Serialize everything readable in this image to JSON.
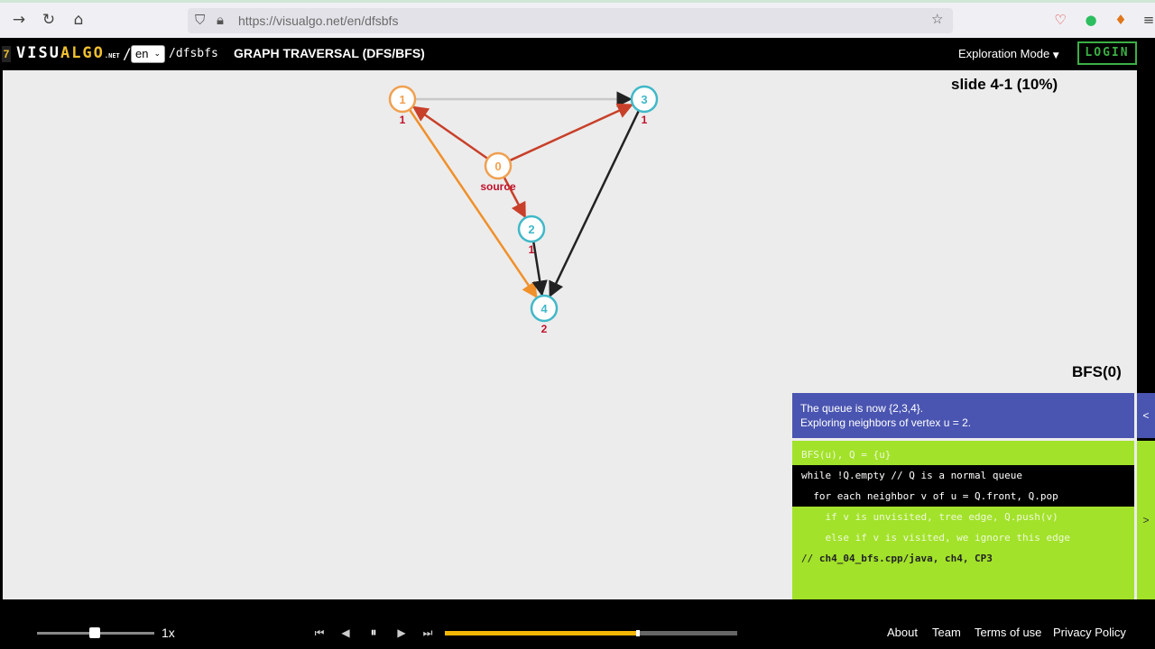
{
  "browser": {
    "url": "https://visualgo.net/en/dfsbfs",
    "icons": [
      "back-arrow-icon",
      "reload-icon",
      "home-icon",
      "shield-icon",
      "lock-icon",
      "star-icon",
      "pocket-icon",
      "evernote-icon",
      "metamask-icon",
      "menu-icon"
    ]
  },
  "header": {
    "logo_num": "7",
    "logo_pre": "VISU",
    "logo_accent": "ALGO",
    "logo_suffix": ".NET",
    "logo_slash": "/",
    "lang": "en",
    "path": "/dfsbfs",
    "title": "GRAPH TRAVERSAL (DFS/BFS)",
    "mode": "Exploration Mode",
    "login": "LOGIN"
  },
  "canvas": {
    "slide": "slide 4-1 (10%)",
    "algo_title": "BFS(0)",
    "status_lines": [
      "The queue is now {2,3,4}.",
      "Exploring neighbors of vertex u = 2."
    ],
    "code": [
      {
        "text": "BFS(u), Q = {u}",
        "style": "dim"
      },
      {
        "text": "while !Q.empty // Q is a normal queue",
        "style": "hl"
      },
      {
        "text": "  for each neighbor v of u = Q.front, Q.pop",
        "style": "hl"
      },
      {
        "text": "    if v is unvisited, tree edge, Q.push(v)",
        "style": "dim"
      },
      {
        "text": "    else if v is visited, we ignore this edge",
        "style": "dim"
      },
      {
        "text_prefix": "// ",
        "text_bold": "ch4_04_bfs.cpp/java, ch4, CP3",
        "style": "cmt"
      }
    ],
    "status_tab_glyph": "<",
    "code_tab_glyph": ">"
  },
  "graph": {
    "vertices": [
      {
        "id": "0",
        "label": "0",
        "sub": "source",
        "state": "explored"
      },
      {
        "id": "1",
        "label": "1",
        "sub": "1",
        "state": "explored"
      },
      {
        "id": "2",
        "label": "2",
        "sub": "1",
        "state": "frontier"
      },
      {
        "id": "3",
        "label": "3",
        "sub": "1",
        "state": "frontier"
      },
      {
        "id": "4",
        "label": "4",
        "sub": "2",
        "state": "frontier"
      }
    ],
    "edges": [
      {
        "from": "1",
        "to": "3",
        "state": "ignored"
      },
      {
        "from": "0",
        "to": "1",
        "state": "tree-explored"
      },
      {
        "from": "0",
        "to": "3",
        "state": "tree-explored"
      },
      {
        "from": "0",
        "to": "2",
        "state": "tree-explored"
      },
      {
        "from": "1",
        "to": "4",
        "state": "tree"
      },
      {
        "from": "2",
        "to": "4",
        "state": "active"
      },
      {
        "from": "3",
        "to": "4",
        "state": "active"
      }
    ],
    "colors": {
      "explored_vertex": "#f0a050",
      "frontier_vertex": "#40b8c8",
      "edge_explored": "#c8402a",
      "edge_tree": "#f0902a",
      "edge_active": "#222222",
      "edge_ignored": "#c8c8c8",
      "sub_label": "#c0102a"
    }
  },
  "player": {
    "speed": "1x",
    "progress": 0.66,
    "icons": [
      "skip-start-icon",
      "step-back-icon",
      "pause-icon",
      "step-forward-icon",
      "skip-end-icon"
    ]
  },
  "footer": {
    "about": "About",
    "team": "Team",
    "terms": "Terms of use",
    "privacy": "Privacy Policy"
  }
}
